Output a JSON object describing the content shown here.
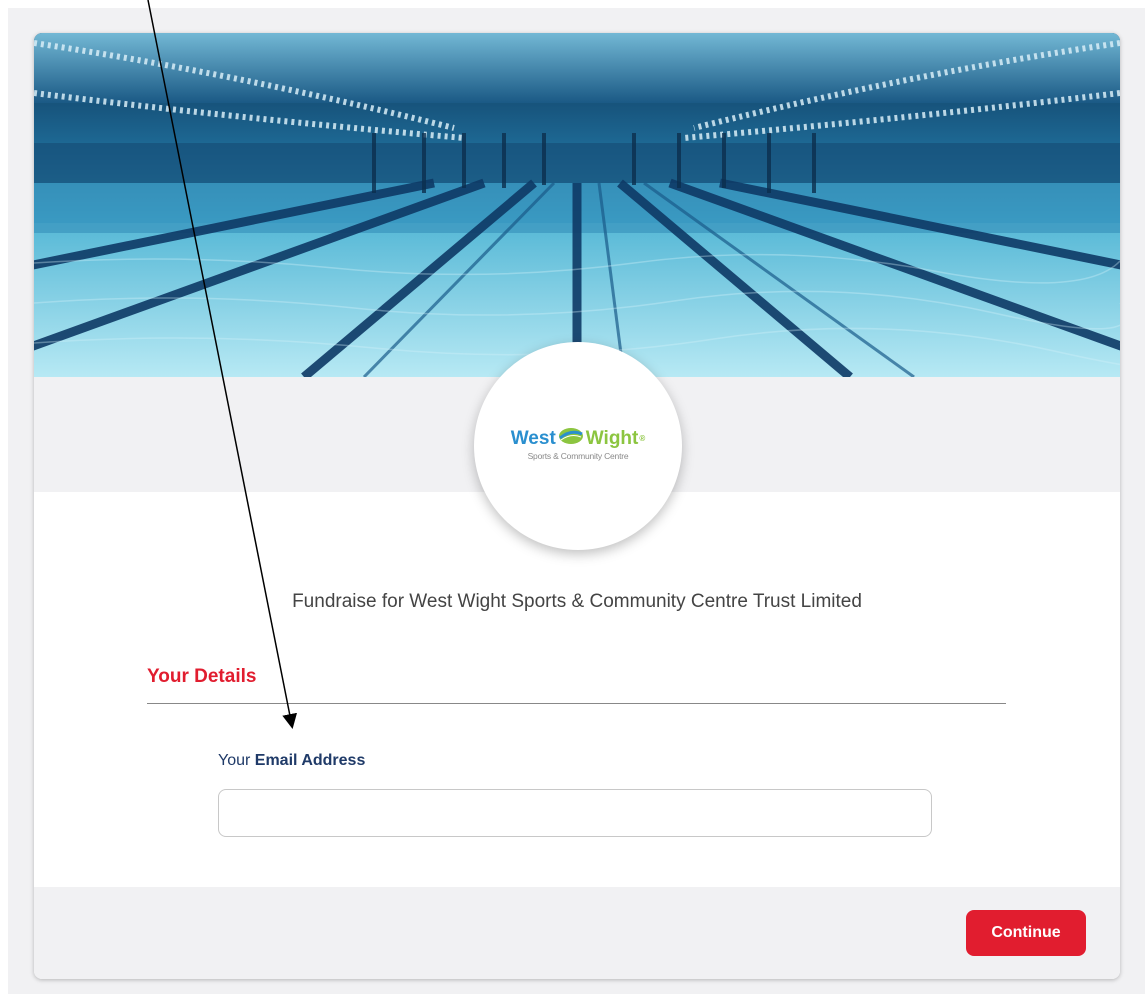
{
  "hero": {
    "image": "swimming-pool-underwater-photo"
  },
  "logo": {
    "name_part1": "West",
    "name_part2": "Wight",
    "registered_mark": "®",
    "subtitle": "Sports & Community Centre",
    "icon": "tennis-ball-icon",
    "colors": {
      "west": "#2a8fcf",
      "wight": "#8cc540"
    }
  },
  "main": {
    "heading": "Fundraise for West Wight Sports & Community Centre Trust Limited"
  },
  "details": {
    "section_title": "Your Details",
    "email_label_prefix": "Your",
    "email_label_strong": "Email Address",
    "email_value": ""
  },
  "footer": {
    "continue_label": "Continue"
  },
  "colors": {
    "accent_red": "#e11d2f",
    "label_navy": "#1f3a68",
    "band_gray": "#f1f1f3"
  }
}
